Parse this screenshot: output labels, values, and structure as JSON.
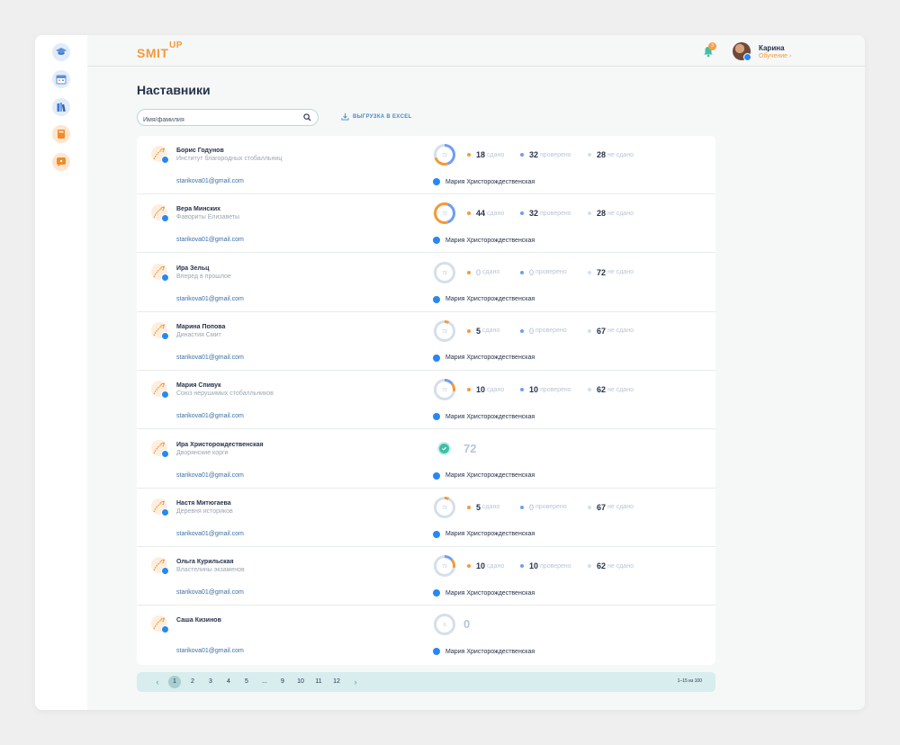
{
  "app": {
    "logo": "SMIT",
    "logo_up": "UP"
  },
  "header": {
    "notification_count": "3",
    "user_name": "Карина",
    "user_role": "Обучение"
  },
  "page": {
    "title": "Наставники",
    "search_placeholder": "Имя/фамилия",
    "export_label": "ВЫГРУЗКА В EXCEL"
  },
  "colors": {
    "accent_orange": "#f39a3b",
    "accent_blue": "#6f9ff0",
    "grey_dot": "#d5dfea",
    "success": "#3fbfa6"
  },
  "labels": {
    "submitted": "сдано",
    "checked": "проверено",
    "not_submitted": "не сдано"
  },
  "rows": [
    {
      "name": "Борис Годунов",
      "team": "Институт благородных стобалльниц",
      "email": "starikova01@gmail.com",
      "mentor": "Мария Христорождественская",
      "type": "stats",
      "total": "72",
      "submitted": "18",
      "checked": "32",
      "not_submitted": "28"
    },
    {
      "name": "Вера Минских",
      "team": "Фавориты Елизаветы",
      "email": "starikova01@gmail.com",
      "mentor": "Мария Христорождественская",
      "type": "stats",
      "total": "72",
      "submitted": "44",
      "checked": "32",
      "not_submitted": "28"
    },
    {
      "name": "Ира Зельц",
      "team": "Вперед в прошлое",
      "email": "starikova01@gmail.com",
      "mentor": "Мария Христорождественская",
      "type": "stats",
      "total": "72",
      "submitted": "0",
      "checked": "0",
      "not_submitted": "72"
    },
    {
      "name": "Марина Попова",
      "team": "Династия Смит",
      "email": "starikova01@gmail.com",
      "mentor": "Мария Христорождественская",
      "type": "stats",
      "total": "72",
      "submitted": "5",
      "checked": "0",
      "not_submitted": "67"
    },
    {
      "name": "Мария Спивук",
      "team": "Союз нерушимых стобалльников",
      "email": "starikova01@gmail.com",
      "mentor": "Мария Христорождественская",
      "type": "stats",
      "total": "72",
      "submitted": "10",
      "checked": "10",
      "not_submitted": "62"
    },
    {
      "name": "Ира Христорождественская",
      "team": "Дворянские корги",
      "email": "starikova01@gmail.com",
      "mentor": "Мария Христорождественская",
      "type": "done",
      "total": "72"
    },
    {
      "name": "Настя Митюгаева",
      "team": "Деревня историков",
      "email": "starikova01@gmail.com",
      "mentor": "Мария Христорождественская",
      "type": "stats",
      "total": "72",
      "submitted": "5",
      "checked": "0",
      "not_submitted": "67"
    },
    {
      "name": "Ольга Курильская",
      "team": "Властелины экзаменов",
      "email": "starikova01@gmail.com",
      "mentor": "Мария Христорождественская",
      "type": "stats",
      "total": "72",
      "submitted": "10",
      "checked": "10",
      "not_submitted": "62"
    },
    {
      "name": "Саша Кизинов",
      "team": "",
      "email": "starikova01@gmail.com",
      "mentor": "Мария Христорождественская",
      "type": "empty",
      "total": "0"
    }
  ],
  "pagination": {
    "prev": "‹",
    "next": "›",
    "pages": [
      "1",
      "2",
      "3",
      "4",
      "5",
      "...",
      "9",
      "10",
      "11",
      "12"
    ],
    "active": "1",
    "range": "1–15 из 100"
  },
  "sidebar": {
    "icons": [
      "graduation-cap-icon",
      "calendar-icon",
      "books-icon",
      "book-icon",
      "help-icon"
    ]
  }
}
